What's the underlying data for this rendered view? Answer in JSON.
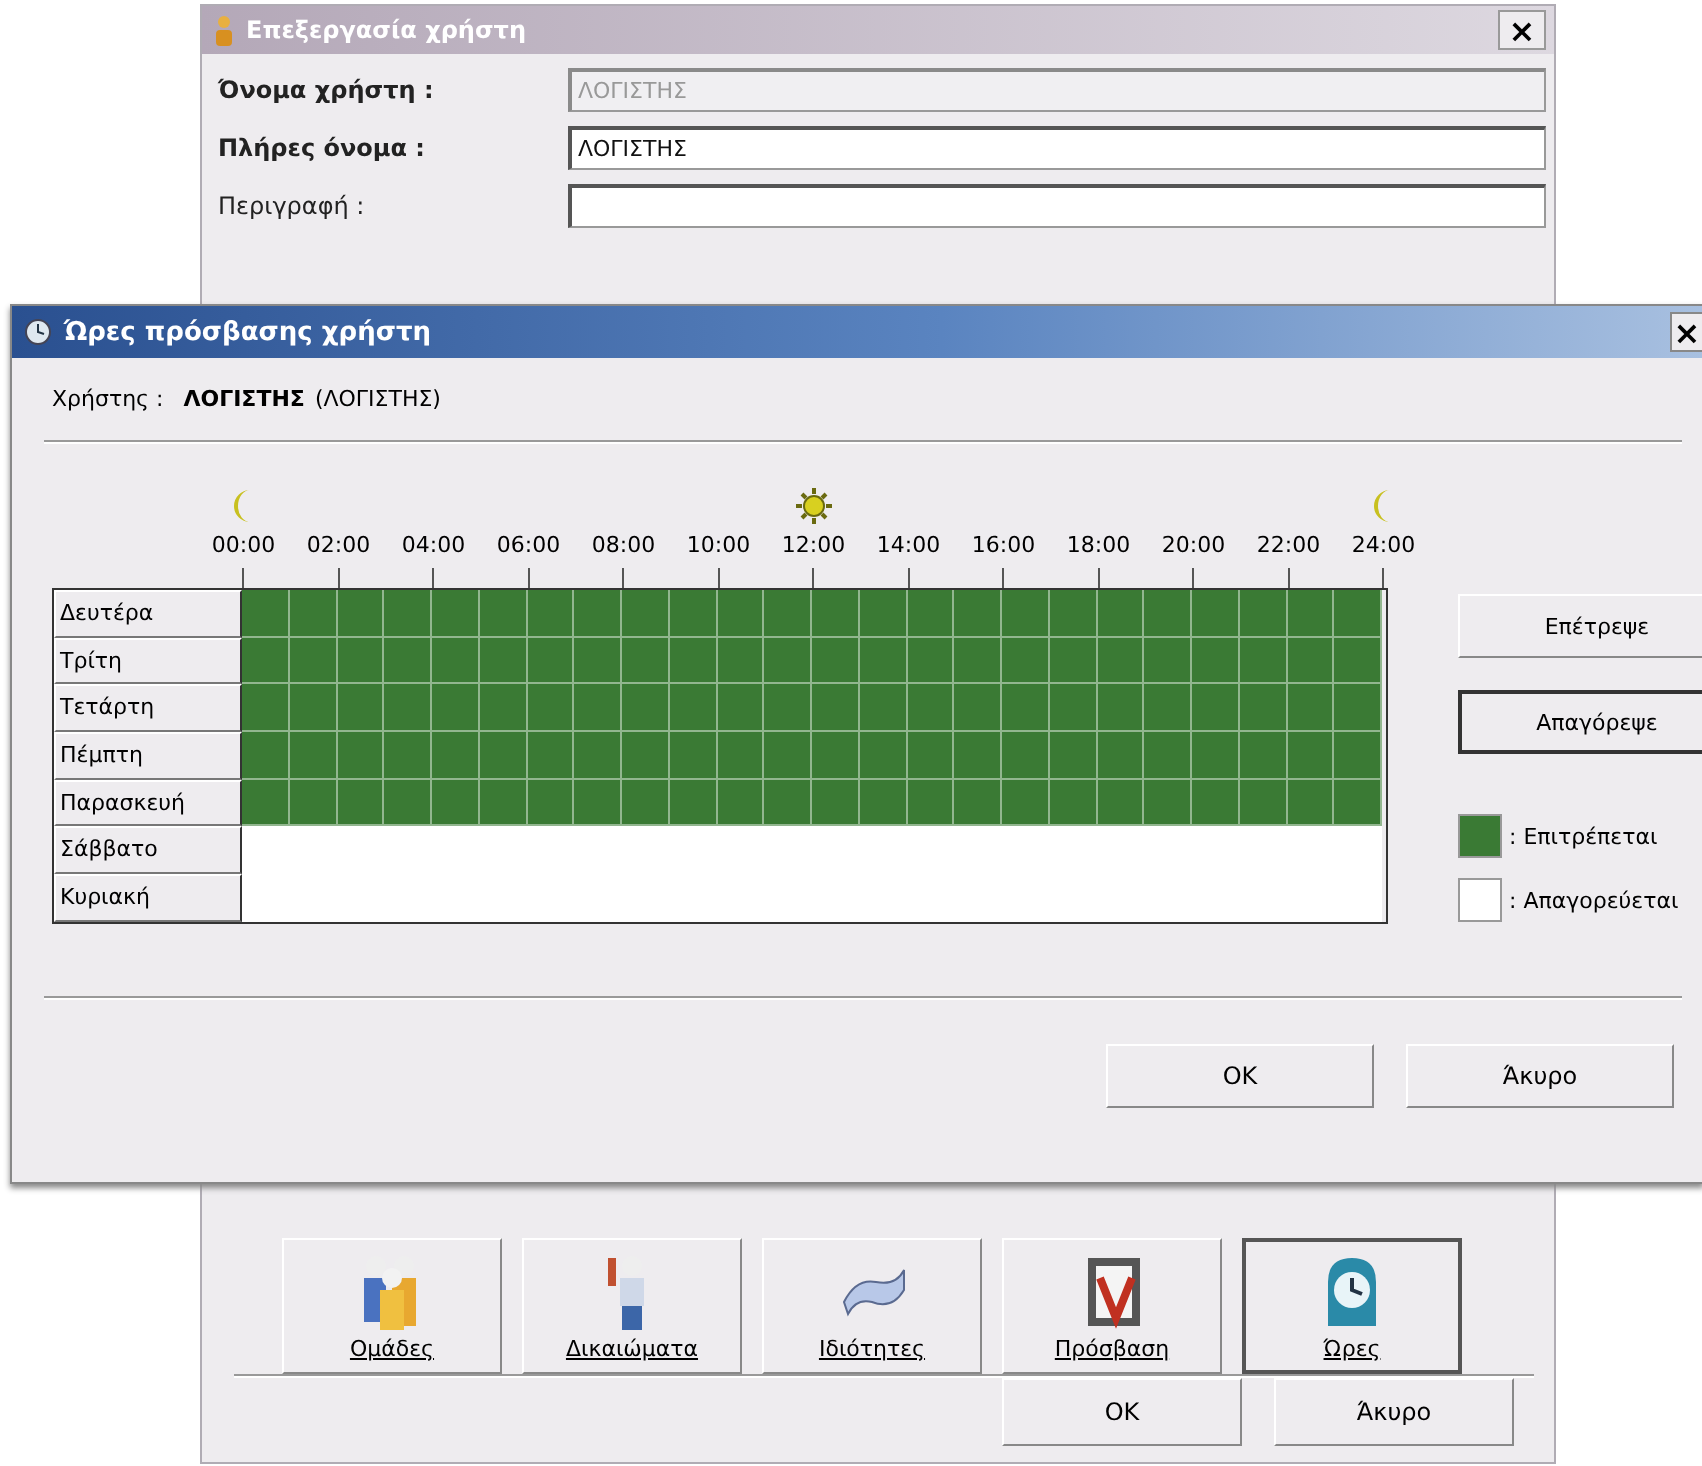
{
  "back_window": {
    "title": "Επεξεργασία χρήστη",
    "close": "×",
    "fields": [
      {
        "label": "Όνομα χρήστη :",
        "value": "ΛΟΓΙΣΤΗΣ",
        "bold": true,
        "disabled": true
      },
      {
        "label": "Πλήρες όνομα :",
        "value": "ΛΟΓΙΣΤΗΣ",
        "bold": true,
        "disabled": false
      },
      {
        "label": "Περιγραφή :",
        "bold": false,
        "disabled": false
      }
    ],
    "icon_buttons": [
      {
        "kind": "groups",
        "label": "Ομάδες",
        "selected": false
      },
      {
        "kind": "rights",
        "label": "Δικαιώματα",
        "selected": false
      },
      {
        "kind": "properties",
        "label": "Ιδιότητες",
        "selected": false
      },
      {
        "kind": "access",
        "label": "Πρόσβαση",
        "selected": false
      },
      {
        "kind": "hours",
        "label": "Ώρες",
        "selected": true
      }
    ],
    "buttons": [
      "OK",
      "Άκυρο"
    ]
  },
  "dialog": {
    "title": "Ώρες πρόσβασης χρήστη",
    "close": "×",
    "user_label": "Χρήστης :",
    "user_name": "ΛΟΓΙΣΤΗΣ",
    "user_login": "(ΛΟΓΙΣΤΗΣ)",
    "hours": [
      "00:00",
      "02:00",
      "04:00",
      "06:00",
      "08:00",
      "10:00",
      "12:00",
      "14:00",
      "16:00",
      "18:00",
      "20:00",
      "22:00",
      "24:00"
    ],
    "days": [
      {
        "label": "Δευτέρα",
        "allowed": true
      },
      {
        "label": "Τρίτη",
        "allowed": true
      },
      {
        "label": "Τετάρτη",
        "allowed": true
      },
      {
        "label": "Πέμπτη",
        "allowed": true
      },
      {
        "label": "Παρασκευή",
        "allowed": true
      },
      {
        "label": "Σάββατο",
        "allowed": false
      },
      {
        "label": "Κυριακή",
        "allowed": false
      }
    ],
    "side_buttons": [
      {
        "label": "Επέτρεψε",
        "focused": false
      },
      {
        "label": "Απαγόρεψε",
        "focused": true
      }
    ],
    "legend": [
      {
        "label": ": Επιτρέπεται",
        "color": "#3a7a34"
      },
      {
        "label": ": Απαγορεύεται",
        "color": "#ffffff"
      }
    ],
    "buttons": [
      "OK",
      "Άκυρο"
    ]
  }
}
